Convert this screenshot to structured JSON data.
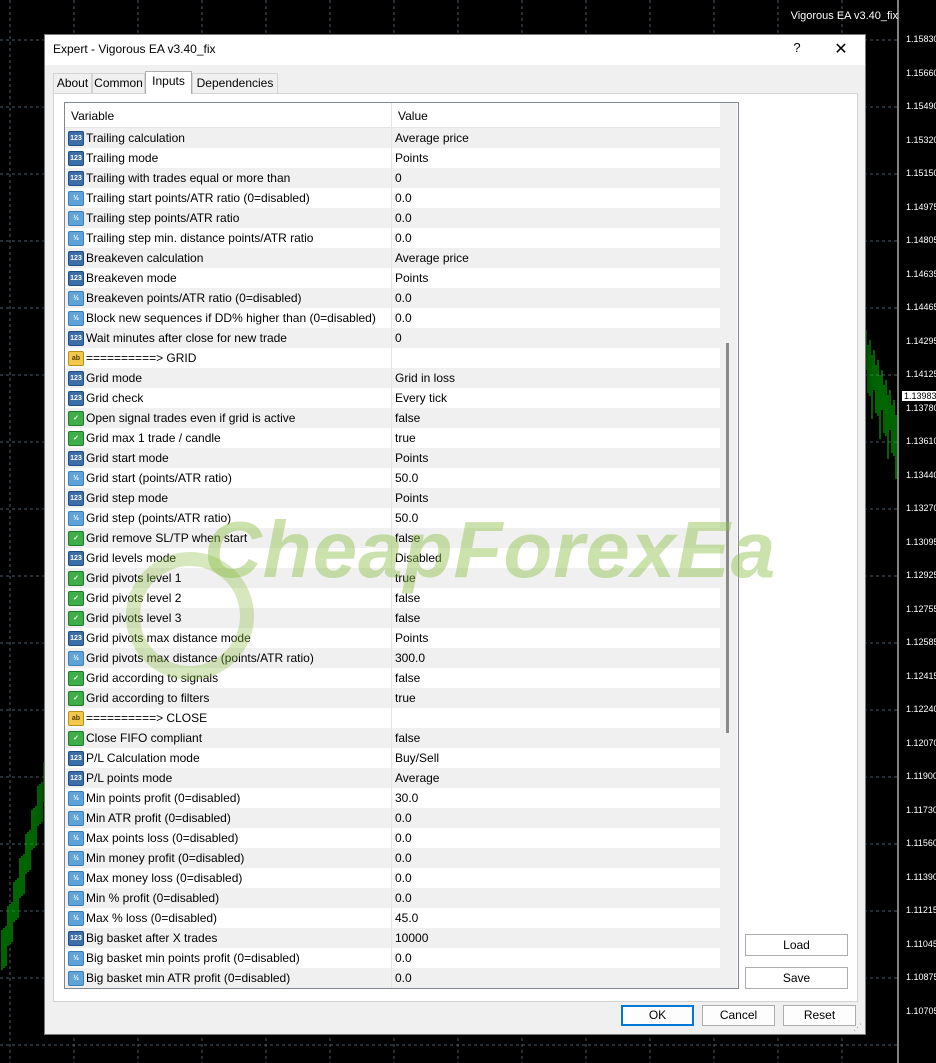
{
  "chart": {
    "title": "Vigorous EA v3.40_fix",
    "prices": [
      "1.15830",
      "1.15660",
      "1.15490",
      "1.15320",
      "1.15150",
      "1.14975",
      "1.14805",
      "1.14635",
      "1.14465",
      "1.14295",
      "1.14125",
      "1.13780",
      "1.13610",
      "1.13440",
      "1.13270",
      "1.13095",
      "1.12925",
      "1.12755",
      "1.12585",
      "1.12415",
      "1.12240",
      "1.12070",
      "1.11900",
      "1.11730",
      "1.11560",
      "1.11390",
      "1.11215",
      "1.11045",
      "1.10875",
      "1.10705"
    ],
    "current_price": "1.13983",
    "colors": {
      "background": "#000000",
      "candles": "#00c800",
      "grid": "#4a5a6a"
    }
  },
  "dialog": {
    "title": "Expert - Vigorous EA v3.40_fix",
    "help": "?",
    "close": "✕"
  },
  "tabs": [
    "About",
    "Common",
    "Inputs",
    "Dependencies"
  ],
  "active_tab": "Inputs",
  "table": {
    "headers": {
      "variable": "Variable",
      "value": "Value"
    },
    "rows": [
      {
        "icon": "num",
        "variable": "Trailing calculation",
        "value": "Average price"
      },
      {
        "icon": "num",
        "variable": "Trailing mode",
        "value": "Points"
      },
      {
        "icon": "num",
        "variable": "Trailing with trades equal or more than",
        "value": "0"
      },
      {
        "icon": "dbl",
        "variable": "Trailing start points/ATR ratio (0=disabled)",
        "value": "0.0"
      },
      {
        "icon": "dbl",
        "variable": "Trailing step points/ATR ratio",
        "value": "0.0"
      },
      {
        "icon": "dbl",
        "variable": "Trailing step min. distance points/ATR ratio",
        "value": "0.0"
      },
      {
        "icon": "num",
        "variable": "Breakeven calculation",
        "value": "Average price"
      },
      {
        "icon": "num",
        "variable": "Breakeven mode",
        "value": "Points"
      },
      {
        "icon": "dbl",
        "variable": "Breakeven points/ATR ratio (0=disabled)",
        "value": "0.0"
      },
      {
        "icon": "dbl",
        "variable": "Block new sequences if DD% higher than (0=disabled)",
        "value": "0.0"
      },
      {
        "icon": "num",
        "variable": "Wait minutes after close for new trade",
        "value": "0"
      },
      {
        "icon": "str",
        "variable": "==========> GRID",
        "value": ""
      },
      {
        "icon": "num",
        "variable": "Grid mode",
        "value": "Grid in loss"
      },
      {
        "icon": "num",
        "variable": "Grid check",
        "value": "Every tick"
      },
      {
        "icon": "bool",
        "variable": "Open signal trades even if grid is active",
        "value": "false"
      },
      {
        "icon": "bool",
        "variable": "Grid max 1 trade / candle",
        "value": "true"
      },
      {
        "icon": "num",
        "variable": "Grid start mode",
        "value": "Points"
      },
      {
        "icon": "dbl",
        "variable": "Grid start (points/ATR ratio)",
        "value": "50.0"
      },
      {
        "icon": "num",
        "variable": "Grid step mode",
        "value": "Points"
      },
      {
        "icon": "dbl",
        "variable": "Grid step (points/ATR ratio)",
        "value": "50.0"
      },
      {
        "icon": "bool",
        "variable": "Grid remove SL/TP when start",
        "value": "false"
      },
      {
        "icon": "num",
        "variable": "Grid levels mode",
        "value": "Disabled"
      },
      {
        "icon": "bool",
        "variable": "Grid pivots level 1",
        "value": "true"
      },
      {
        "icon": "bool",
        "variable": "Grid pivots level 2",
        "value": "false"
      },
      {
        "icon": "bool",
        "variable": "Grid pivots level 3",
        "value": "false"
      },
      {
        "icon": "num",
        "variable": "Grid pivots max distance mode",
        "value": "Points"
      },
      {
        "icon": "dbl",
        "variable": "Grid pivots max distance (points/ATR ratio)",
        "value": "300.0"
      },
      {
        "icon": "bool",
        "variable": "Grid according to signals",
        "value": "false"
      },
      {
        "icon": "bool",
        "variable": "Grid according to filters",
        "value": "true"
      },
      {
        "icon": "str",
        "variable": "==========> CLOSE",
        "value": ""
      },
      {
        "icon": "bool",
        "variable": "Close FIFO compliant",
        "value": "false"
      },
      {
        "icon": "num",
        "variable": "P/L Calculation mode",
        "value": "Buy/Sell"
      },
      {
        "icon": "num",
        "variable": "P/L points mode",
        "value": "Average"
      },
      {
        "icon": "dbl",
        "variable": "Min points profit (0=disabled)",
        "value": "30.0"
      },
      {
        "icon": "dbl",
        "variable": "Min ATR profit (0=disabled)",
        "value": "0.0"
      },
      {
        "icon": "dbl",
        "variable": "Max points loss (0=disabled)",
        "value": "0.0"
      },
      {
        "icon": "dbl",
        "variable": "Min money profit (0=disabled)",
        "value": "0.0"
      },
      {
        "icon": "dbl",
        "variable": "Max money loss (0=disabled)",
        "value": "0.0"
      },
      {
        "icon": "dbl",
        "variable": "Min % profit (0=disabled)",
        "value": "0.0"
      },
      {
        "icon": "dbl",
        "variable": "Max % loss (0=disabled)",
        "value": "45.0"
      },
      {
        "icon": "num",
        "variable": "Big basket after X trades",
        "value": "10000"
      },
      {
        "icon": "dbl",
        "variable": "Big basket min points profit (0=disabled)",
        "value": "0.0"
      },
      {
        "icon": "dbl",
        "variable": "Big basket min ATR profit (0=disabled)",
        "value": "0.0"
      }
    ]
  },
  "icon_labels": {
    "num": "123",
    "dbl": "½",
    "bool": "✓",
    "str": "ab"
  },
  "side_buttons": {
    "load": "Load",
    "save": "Save"
  },
  "bottom_buttons": {
    "ok": "OK",
    "cancel": "Cancel",
    "reset": "Reset"
  },
  "watermark": "CheapForexEa"
}
